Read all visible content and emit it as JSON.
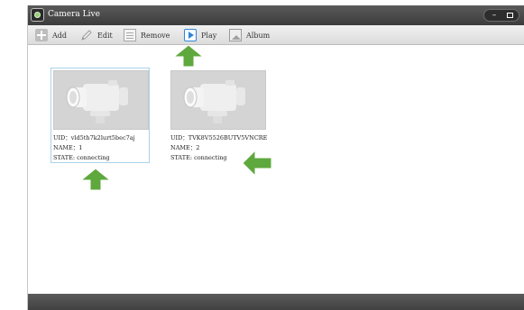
{
  "window": {
    "title": "Camera Live",
    "minimize_label": "–"
  },
  "toolbar": {
    "add_label": "Add",
    "edit_label": "Edit",
    "remove_label": "Remove",
    "play_label": "Play",
    "album_label": "Album"
  },
  "cameras": [
    {
      "uid": "UID：vld5th7k2lurt5bec7aj",
      "name": "NAME：1",
      "state": "STATE: connecting"
    },
    {
      "uid": "UID：TVK8V5526BUTV5VNCRE1",
      "name": "NAME：2",
      "state": "STATE: connecting"
    }
  ],
  "colors": {
    "titlebar": "#4a4a4a",
    "selected_border": "#a9d2ea",
    "arrow_green": "#5fa83d",
    "play_accent": "#2f86d6"
  },
  "icons": [
    "camera-live-icon",
    "add-icon",
    "edit-icon",
    "remove-icon",
    "play-icon",
    "album-icon",
    "camera-thumbnail",
    "green-arrow"
  ]
}
